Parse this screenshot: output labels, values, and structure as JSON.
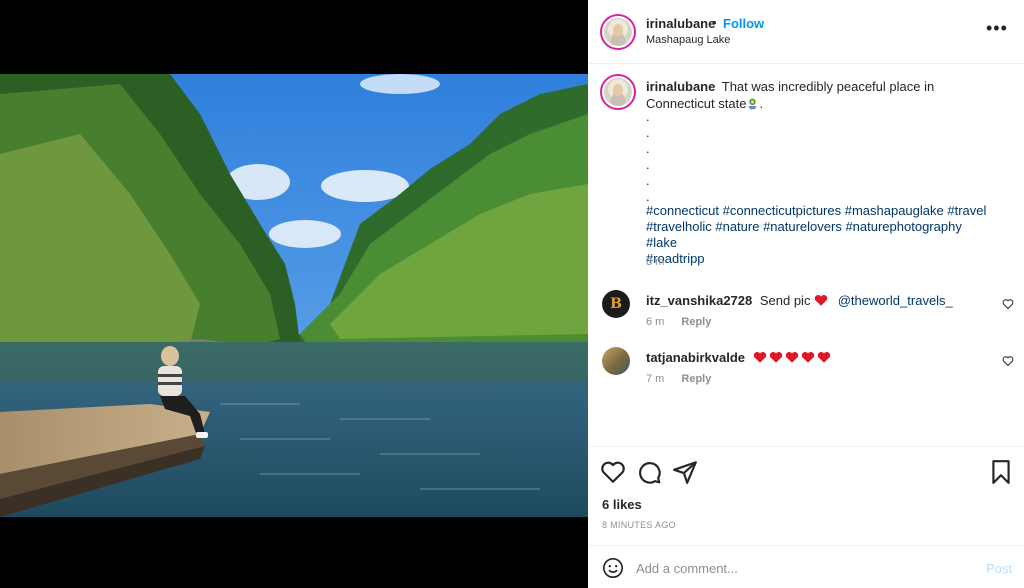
{
  "post": {
    "username": "irinalubane",
    "follow_label": "Follow",
    "separator": "•",
    "location": "Mashapaug Lake",
    "more_label": "•••"
  },
  "caption": {
    "username": "irinalubane",
    "text": "That was incredibly peaceful place in Connecticut state",
    "text_end": ".",
    "dots": [
      ".",
      ".",
      ".",
      ".",
      ".",
      "."
    ],
    "hashtags_line1": "#connecticut #connecticutpictures #mashapauglake #travel",
    "hashtags_line2": "#travelholic #nature #naturelovers #naturephotography #lake",
    "hashtags_line3": "#roadtripp",
    "time": "8 m"
  },
  "comments": [
    {
      "username": "itz_vanshika2728",
      "text": "Send pic",
      "mention": "@theworld_travels_",
      "avatar_letter": "B",
      "time": "6 m",
      "reply_label": "Reply"
    },
    {
      "username": "tatjanabirkvalde",
      "text": "",
      "heart_count": 5,
      "time": "7 m",
      "reply_label": "Reply"
    }
  ],
  "actions": {
    "likes": "6 likes",
    "posted": "8 MINUTES AGO"
  },
  "composer": {
    "placeholder": "Add a comment...",
    "post_label": "Post"
  },
  "colors": {
    "link_blue": "#0095f6",
    "hashtag": "#00376b",
    "muted": "#8e8e8e",
    "heart_red": "#e0162b"
  }
}
